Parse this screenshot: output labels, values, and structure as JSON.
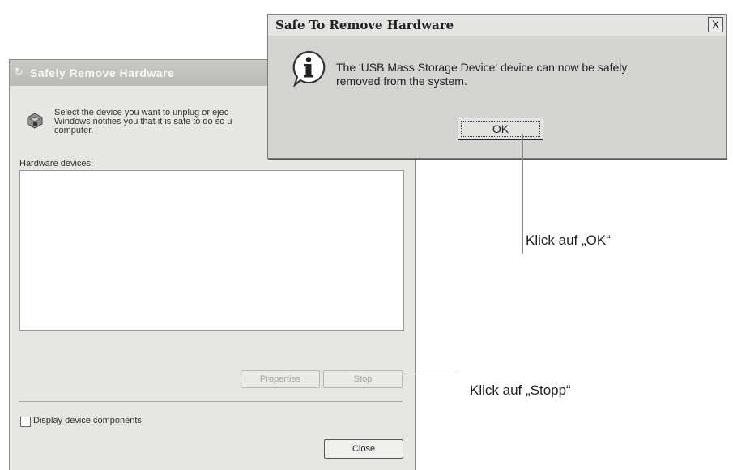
{
  "main_window": {
    "title": "Safely Remove Hardware",
    "intro_line1": "Select the device you want to unplug or ejec",
    "intro_line2": "Windows notifies you that it is safe to do so u",
    "intro_line3": "computer.",
    "hardware_label": "Hardware devices:",
    "properties_label": "Properties",
    "stop_label": "Stop",
    "display_components_label": "Display device components",
    "close_label": "Close"
  },
  "dialog": {
    "title": "Safe To Remove Hardware",
    "close_glyph": "X",
    "message_line1": "The 'USB Mass Storage Device' device can now be safely",
    "message_line2": "removed from the system.",
    "ok_label": "OK"
  },
  "callouts": {
    "ok": "Klick auf „OK“",
    "stop": "Klick auf „Stopp“"
  }
}
